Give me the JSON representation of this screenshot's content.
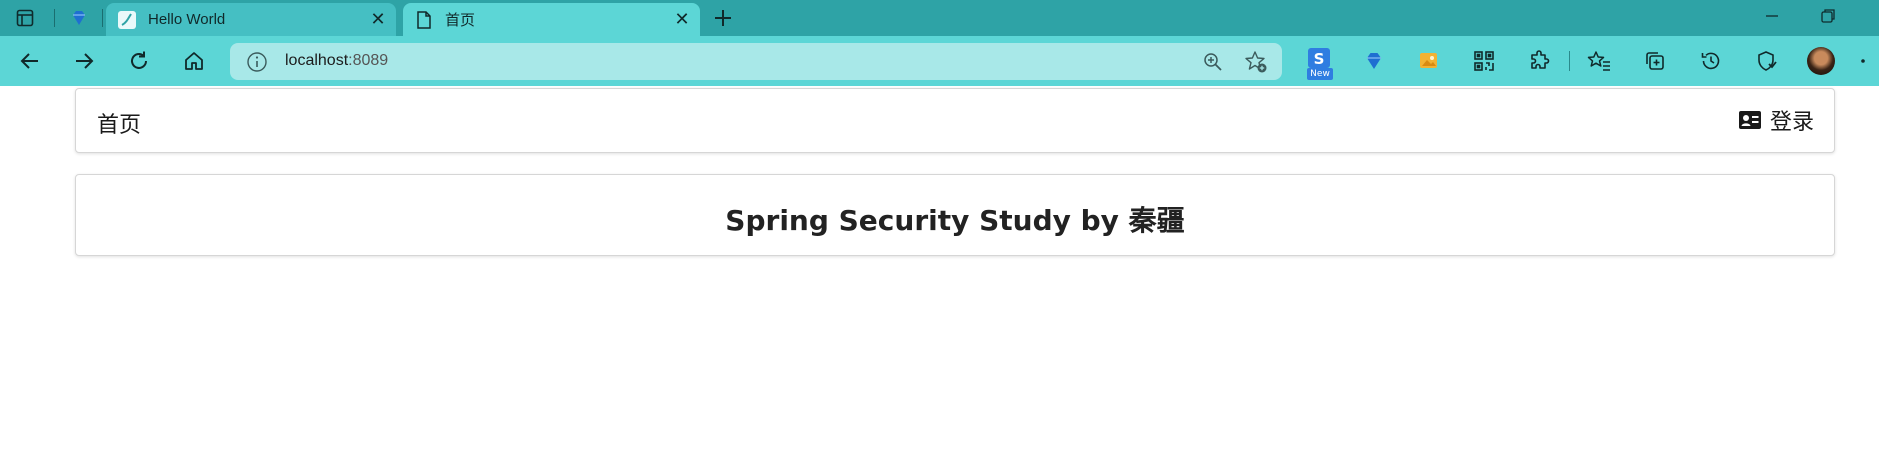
{
  "browser": {
    "tabs": [
      {
        "title": "Hello World",
        "active": false
      },
      {
        "title": "首页",
        "active": true
      }
    ],
    "address": {
      "host": "localhost",
      "port": ":8089"
    },
    "extension_badge": "New"
  },
  "page": {
    "menu": {
      "home_label": "首页",
      "login_label": "登录"
    },
    "heading": "Spring Security Study by 秦疆"
  },
  "colors": {
    "tabstrip": "#2ea3a6",
    "toolbar": "#5cd6d6",
    "omnibox": "#a8e8e8"
  }
}
